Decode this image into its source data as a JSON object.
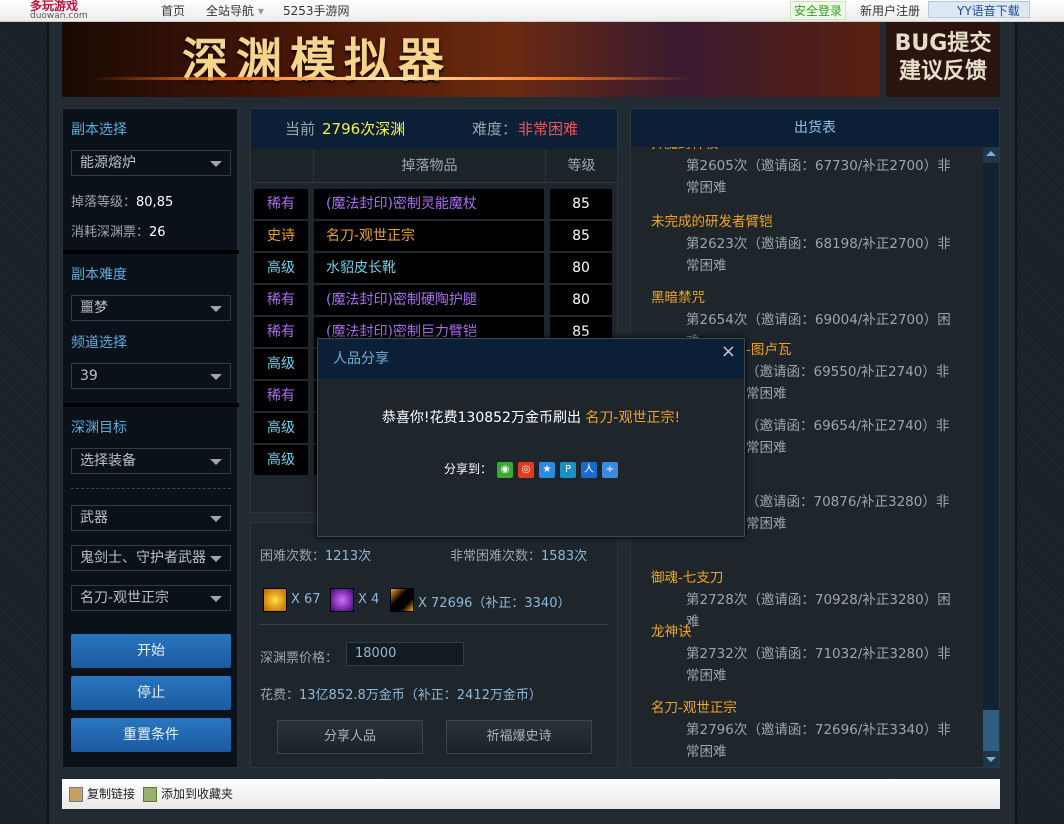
{
  "topnav": {
    "logo": "多玩游戏",
    "logo_sub": "duowan.com",
    "items": [
      "首页",
      "全站导航",
      "5253手游网"
    ],
    "login": "安全登录",
    "register": "新用户注册",
    "yy": "YY语音下载"
  },
  "banner": {
    "title": "深渊模拟器",
    "bug": "BUG提交",
    "bug2": "建议反馈"
  },
  "left": {
    "dungeon_label": "副本选择",
    "dungeon": "能源熔炉",
    "drop_level_label": "掉落等级：",
    "drop_level": "80,85",
    "ticket_label": "消耗深渊票：",
    "ticket": "26",
    "difficulty_label": "副本难度",
    "difficulty": "噩梦",
    "channel_label": "频道选择",
    "channel": "39",
    "target_label": "深渊目标",
    "target": "选择装备",
    "type": "武器",
    "class": "鬼剑士、守护者武器",
    "item": "名刀-观世正宗",
    "start": "开始",
    "stop": "停止",
    "reset": "重置条件"
  },
  "center": {
    "current_label": "当前",
    "current": "2796次深渊",
    "diff_label": "难度：",
    "diff": "非常困难",
    "col_item": "掉落物品",
    "col_level": "等级",
    "rows": [
      {
        "rarity": "稀有",
        "name": "(魔法封印)密制灵能魔杖",
        "level": "85",
        "color": "#a86ef0"
      },
      {
        "rarity": "史诗",
        "name": "名刀-观世正宗",
        "level": "85",
        "color": "#f0a420"
      },
      {
        "rarity": "高级",
        "name": "水貂皮长靴",
        "level": "80",
        "color": "#6ad0e8"
      },
      {
        "rarity": "稀有",
        "name": "(魔法封印)密制硬陶护腿",
        "level": "80",
        "color": "#a86ef0"
      },
      {
        "rarity": "稀有",
        "name": "(魔法封印)密制巨力臂铠",
        "level": "85",
        "color": "#a86ef0"
      },
      {
        "rarity": "高级",
        "name": "",
        "level": "",
        "color": "#6ad0e8"
      },
      {
        "rarity": "稀有",
        "name": "",
        "level": "",
        "color": "#a86ef0"
      },
      {
        "rarity": "高级",
        "name": "",
        "level": "",
        "color": "#6ad0e8"
      },
      {
        "rarity": "高级",
        "name": "",
        "level": "",
        "color": "#6ad0e8"
      }
    ]
  },
  "stats": {
    "hard_label": "困难次数：",
    "hard": "1213次",
    "vhard_label": "非常困难次数：",
    "vhard": "1583次",
    "icon1_count": "X 67",
    "icon2_count": "X 4",
    "icon3_count": "X 72696（补正：3340）",
    "price_label": "深渊票价格：",
    "price": "18000",
    "cost_label": "花费：",
    "cost": "13亿852.8万金币（补正：2412万金币）",
    "share_btn": "分享人品",
    "pray_btn": "祈福爆史诗"
  },
  "right": {
    "title": "出货表",
    "entries": [
      {
        "name": "异魔封神杖",
        "detail": "第2605次（邀请函：67730/补正2700）非常困难"
      },
      {
        "name": "未完成的研发者臂铠",
        "detail": "第2623次（邀请函：68198/补正2700）非常困难"
      },
      {
        "name": "黑暗禁咒",
        "detail": "第2654次（邀请函：69004/补正2700）困难"
      },
      {
        "name": "-图卢瓦",
        "detail": "（邀请函：69550/补正2740）非常困难"
      },
      {
        "name": "",
        "detail": "（邀请函：69654/补正2740）非常困难"
      },
      {
        "name": "",
        "detail": "（邀请函：70876/补正3280）非常困难"
      },
      {
        "name": "御魂-七支刀",
        "detail": "第2728次（邀请函：70928/补正3280）困难"
      },
      {
        "name": "龙神诀",
        "detail": "第2732次（邀请函：71032/补正3280）非常困难"
      },
      {
        "name": "名刀-观世正宗",
        "detail": "第2796次（邀请函：72696/补正3340）非常困难"
      }
    ]
  },
  "bottom": {
    "copy": "复制链接",
    "fav": "添加到收藏夹"
  },
  "modal": {
    "title": "人品分享",
    "close": "×",
    "msg": "恭喜你!花费130852万金币刷出",
    "item": "名刀-观世正宗!",
    "share_label": "分享到：",
    "share_icons": [
      "wechat-icon",
      "weibo-icon",
      "qzone-icon",
      "tencent-weibo-icon",
      "renren-icon",
      "more-icon"
    ]
  }
}
